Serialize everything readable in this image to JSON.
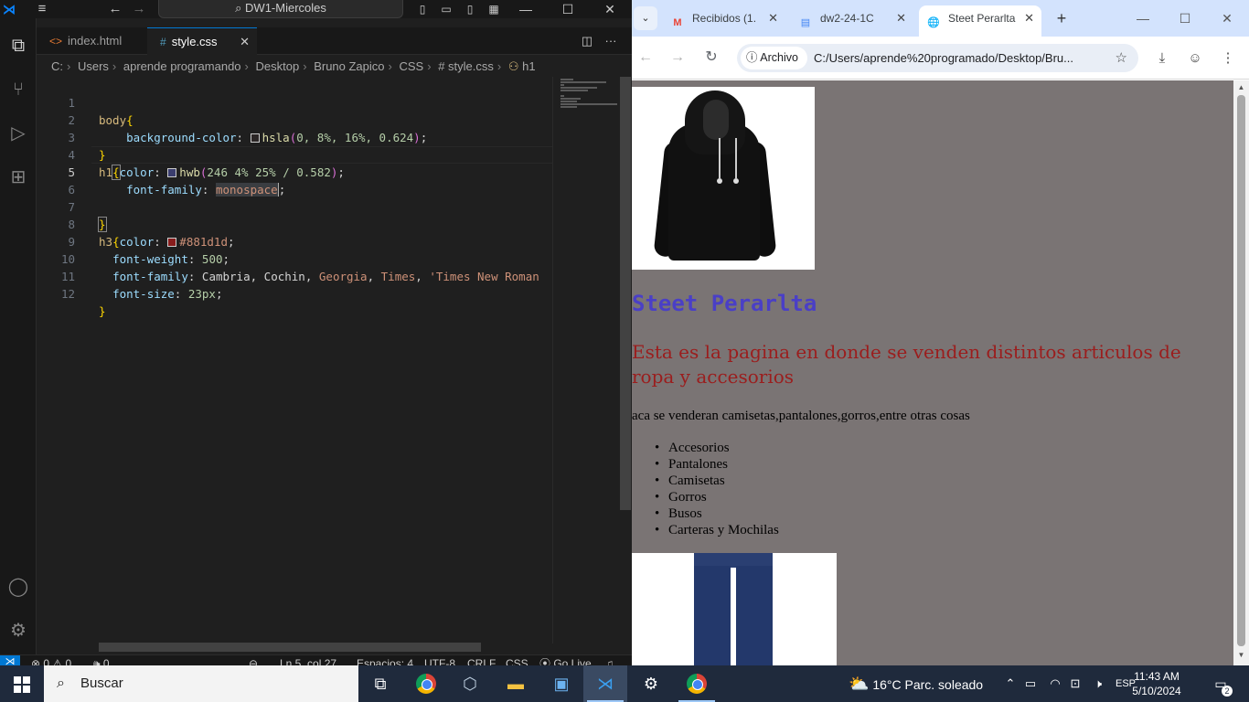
{
  "vscode": {
    "window_title": "DW1-Miercoles",
    "tabs": [
      {
        "label": "index.html",
        "icon": "<>"
      },
      {
        "label": "style.css",
        "icon": "#"
      }
    ],
    "breadcrumb": [
      "C:",
      "Users",
      "aprende programando",
      "Desktop",
      "Bruno Zapico",
      "CSS",
      "# style.css",
      "h1"
    ],
    "line_numbers": [
      "1",
      "2",
      "3",
      "4",
      "5",
      "6",
      "7",
      "8",
      "9",
      "10",
      "11",
      "12"
    ],
    "code": {
      "l1_sel": "body",
      "l1_brace": "{",
      "l2_prop": "background-color",
      "l2_fn": "hsla",
      "l2_args": "0, 8%, 16%, 0.624",
      "l3_brace": "}",
      "l4_sel": "h1",
      "l4_brace": "{",
      "l4_prop": "color",
      "l4_fn": "hwb",
      "l4_args": "246 4% 25% / 0.582",
      "l5_prop": "font-family",
      "l5_val": "monospace",
      "l7_brace": "}",
      "l8_sel": "h3",
      "l8_brace": "{",
      "l8_prop": "color",
      "l8_val": "#881d1d",
      "l9_prop": "font-weight",
      "l9_val": "500",
      "l10_prop": "font-family",
      "l10_val1": "Cambria",
      "l10_val2": "Cochin",
      "l10_val3": "Georgia",
      "l10_val4": "Times",
      "l10_val5": "'Times New Roman",
      "l11_prop": "font-size",
      "l11_val": "23px",
      "l12_brace": "}"
    },
    "swatches": {
      "body_bg": "#2b2626",
      "h1_color": "#3a3d6e",
      "h3_color": "#881d1d"
    },
    "status": {
      "errors": "⊗ 0 ⚠ 0",
      "ports": "🕪 0",
      "position": "Ln 5, col 27",
      "spaces": "Espacios: 4",
      "encoding": "UTF-8",
      "eol": "CRLF",
      "language": "CSS",
      "golive": "Go Live"
    }
  },
  "chrome": {
    "tabs": [
      {
        "label": "Recibidos (1.",
        "favicon": "M",
        "color": "#ea4335"
      },
      {
        "label": "dw2-24-1C",
        "favicon": "▤",
        "color": "#4285f4"
      },
      {
        "label": "Steet Perarlta",
        "favicon": "🌐",
        "color": "#5f6368"
      }
    ],
    "omnibox": {
      "chip": "Archivo",
      "url": "C:/Users/aprende%20programado/Desktop/Bru..."
    },
    "page": {
      "h1": "Steet Perarlta",
      "h3": "Esta es la pagina en donde se venden distintos articulos de ropa y accesorios",
      "p": "aca se venderan camisetas,pantalones,gorros,entre otras cosas",
      "items": [
        "Accesorios",
        "Pantalones",
        "Camisetas",
        "Gorros",
        "Busos",
        "Carteras y Mochilas"
      ],
      "bg_color": "#7a7474",
      "h1_color": "#4a3fc6",
      "h3_color": "#9b1d1d"
    }
  },
  "taskbar": {
    "search": "Buscar",
    "weather": "16°C  Parc. soleado",
    "lang": "ESP",
    "time": "11:43 AM",
    "date": "5/10/2024",
    "notifications": "2"
  }
}
